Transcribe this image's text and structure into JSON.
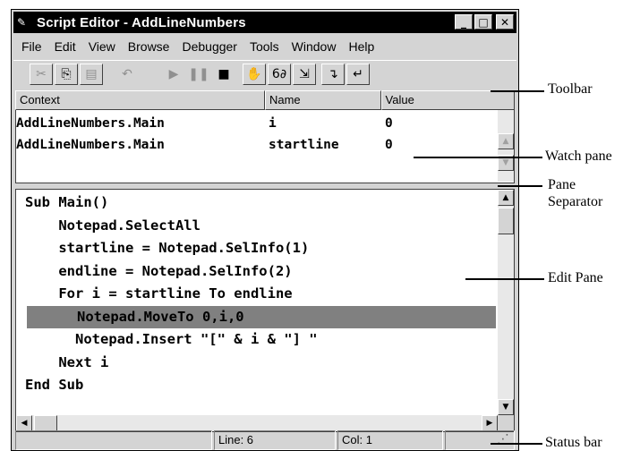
{
  "window": {
    "title": "Script Editor - AddLineNumbers",
    "title_icon": "script-icon",
    "controls": [
      "minimize-icon",
      "maximize-icon",
      "close-icon"
    ]
  },
  "menu": [
    "File",
    "Edit",
    "View",
    "Browse",
    "Debugger",
    "Tools",
    "Window",
    "Help"
  ],
  "toolbar": {
    "buttons": [
      {
        "icon": "cut-icon",
        "glyph": "✂",
        "enabled": false
      },
      {
        "icon": "copy-icon",
        "glyph": "⎘",
        "enabled": true
      },
      {
        "icon": "paste-icon",
        "glyph": "📋",
        "enabled": false
      },
      {
        "icon": "undo-icon",
        "glyph": "↶",
        "enabled": false
      },
      {
        "icon": "run-icon",
        "glyph": "▶",
        "enabled": false
      },
      {
        "icon": "pause-icon",
        "glyph": "❚❚",
        "enabled": false
      },
      {
        "icon": "stop-icon",
        "glyph": "■",
        "enabled": true
      },
      {
        "icon": "toggle-breakpoint-icon",
        "glyph": "✋",
        "enabled": true
      },
      {
        "icon": "quick-watch-icon",
        "glyph": "6∂",
        "enabled": true
      },
      {
        "icon": "step-into-icon",
        "glyph": "⇲",
        "enabled": true
      },
      {
        "icon": "step-over-icon",
        "glyph": "↴",
        "enabled": true
      },
      {
        "icon": "step-out-icon",
        "glyph": "↵",
        "enabled": true
      }
    ]
  },
  "watch": {
    "columns": [
      "Context",
      "Name",
      "Value"
    ],
    "rows": [
      {
        "context": "AddLineNumbers.Main",
        "name": "i",
        "value": "0"
      },
      {
        "context": "AddLineNumbers.Main",
        "name": "startline",
        "value": "0"
      }
    ]
  },
  "editor": {
    "lines": [
      "Sub Main()",
      "    Notepad.SelectAll",
      "    startline = Notepad.SelInfo(1)",
      "    endline = Notepad.SelInfo(2)",
      "    For i = startline To endline",
      "      Notepad.MoveTo 0,i,0",
      "      Notepad.Insert \"[\" & i & \"] \"",
      "    Next i",
      "End Sub"
    ],
    "highlighted_line_index": 5
  },
  "status": {
    "line": "Line: 6",
    "col": "Col: 1"
  },
  "callouts": {
    "toolbar": "Toolbar",
    "watch_pane": "Watch pane",
    "pane_separator_1": "Pane",
    "pane_separator_2": "Separator",
    "edit_pane": "Edit Pane",
    "status_bar": "Status bar"
  }
}
